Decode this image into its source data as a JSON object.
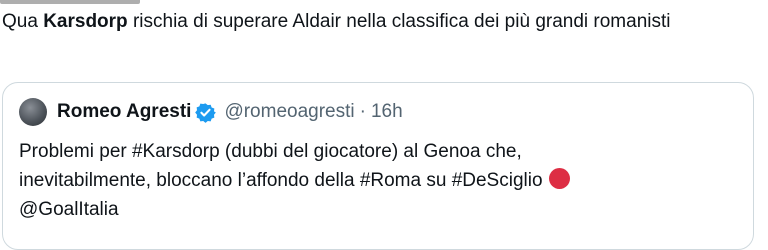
{
  "tweet": {
    "text_before": "Qua ",
    "text_bold": "Karsdorp",
    "text_after": " rischia di superare Aldair nella classifica dei più grandi romanisti"
  },
  "quoted_tweet": {
    "display_name": "Romeo Agresti",
    "handle": "@romeoagresti",
    "separator": "·",
    "time": "16h",
    "line1": "Problemi per #Karsdorp (dubbi del giocatore) al Genoa che,",
    "line2": "inevitabilmente, bloccano l’affondo della #Roma su #DeSciglio",
    "line3": "@GoalItalia"
  },
  "colors": {
    "verified": "#1d9bf0",
    "muted": "#536471",
    "red_circle": "#dd2e44"
  }
}
